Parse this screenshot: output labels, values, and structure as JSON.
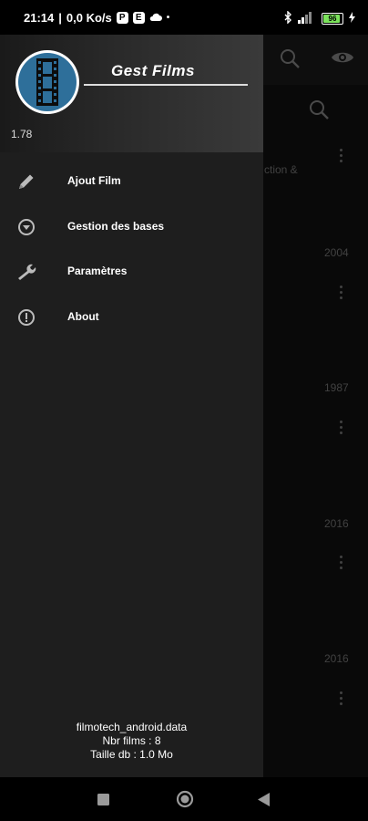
{
  "status_bar": {
    "time": "21:14",
    "separator": "|",
    "net_speed": "0,0 Ko/s",
    "badge_p": "P",
    "badge_e": "E",
    "battery": "96"
  },
  "background": {
    "snippet_text": "ction &",
    "years": [
      "2004",
      "1987",
      "2016",
      "2016"
    ]
  },
  "drawer": {
    "app_title": "Gest Films",
    "version": "1.78",
    "menu": [
      {
        "label": "Ajout Film",
        "icon": "pencil-icon"
      },
      {
        "label": "Gestion des bases",
        "icon": "chevron-circle-icon"
      },
      {
        "label": "Paramètres",
        "icon": "wrench-icon"
      },
      {
        "label": "About",
        "icon": "info-icon"
      }
    ],
    "footer": {
      "db_file": "filmotech_android.data",
      "film_count": "Nbr films : 8",
      "db_size": "Taille db : 1.0 Mo"
    }
  }
}
